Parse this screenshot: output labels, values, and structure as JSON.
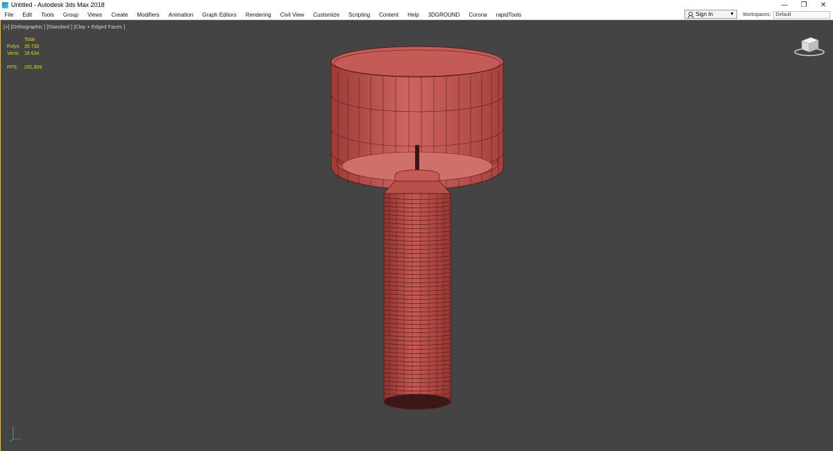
{
  "window": {
    "title": "Untitled - Autodesk 3ds Max 2018",
    "minimize_glyph": "—",
    "restore_glyph": "❐",
    "close_glyph": "✕"
  },
  "menu": {
    "items": [
      "File",
      "Edit",
      "Tools",
      "Group",
      "Views",
      "Create",
      "Modifiers",
      "Animation",
      "Graph Editors",
      "Rendering",
      "Civil View",
      "Customize",
      "Scripting",
      "Content",
      "Help",
      "3DGROUND",
      "Corona",
      "rapidTools"
    ]
  },
  "account": {
    "sign_in_label": "Sign In",
    "workspaces_label": "Workspaces:",
    "workspace_value": "Default"
  },
  "viewport": {
    "label": "[+] [Orthographic ] [Standard ] [Clay + Edged Faces ]",
    "stats": {
      "header": "Total",
      "polys_label": "Polys:",
      "polys_value": "35 730",
      "verts_label": "Verts:",
      "verts_value": "18 634",
      "fps_label": "FPS:",
      "fps_value": "291,809"
    }
  },
  "colors": {
    "mesh_fill": "#c25550",
    "mesh_edge": "#5a1d1b",
    "viewport_bg": "#444444",
    "stats_text": "#e3d41e"
  },
  "icons": [
    "app-icon",
    "user-icon",
    "chevron-down-icon",
    "viewcube-icon",
    "axis-tripod-icon"
  ]
}
